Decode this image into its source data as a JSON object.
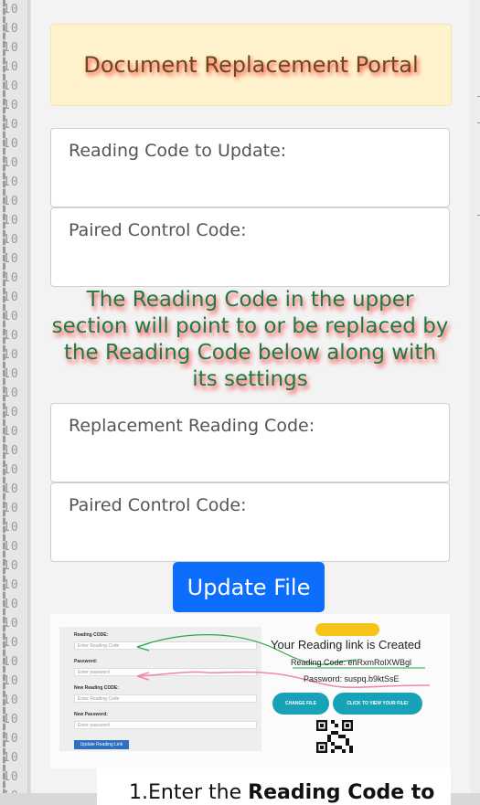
{
  "binary_strip": [
    "10",
    "10",
    "10",
    "10",
    "10",
    "10",
    "10",
    "10",
    "10",
    "10",
    "10",
    "10",
    "10",
    "10",
    "10",
    "10",
    "10",
    "10",
    "10",
    "10",
    "10",
    "10",
    "10",
    "10",
    "10",
    "10",
    "10",
    "10",
    "10",
    "10",
    "10",
    "10",
    "10",
    "10",
    "10",
    "10",
    "10",
    "10",
    "10",
    "10",
    "10",
    "10"
  ],
  "header": {
    "title": "Document Replacement Portal"
  },
  "fields": {
    "reading_code_update": "Reading Code to Update:",
    "paired_control_1": "Paired Control Code:",
    "replacement_reading": "Replacement Reading Code:",
    "paired_control_2": "Paired Control Code:"
  },
  "note": "The Reading Code in the upper section will point to or be replaced by the Reading Code below along with its settings",
  "update_button": "Update File",
  "preview": {
    "form": {
      "reading_code_label": "Reading CODE:",
      "reading_code_placeholder": "Enter Reading Code",
      "password_label": "Password:",
      "password_placeholder": "Enter password",
      "new_reading_label": "New Reading CODE:",
      "new_reading_placeholder": "Enter Reading Code",
      "new_password_label": "New Password:",
      "new_password_placeholder": "Enter password",
      "button": "Update Reading Link"
    },
    "result": {
      "title": "Your Reading link is Created",
      "reading_code": "Reading Code:  enRxmRolXWBgl",
      "password": "Password:  suspq.b9ktSsE",
      "change_file": "CHANGE FILE",
      "view_file": "CLICK TO VIEW YOUR FILE!"
    }
  },
  "bottom": {
    "text_plain": "1.Enter the ",
    "text_bold": "Reading Code to"
  },
  "colors": {
    "accent": "#0d6efd",
    "note_text": "#1f7a45",
    "title_bg": "#fff3cd"
  }
}
